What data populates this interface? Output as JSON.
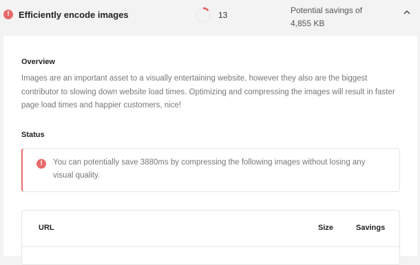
{
  "audit": {
    "title": "Efficiently encode images",
    "score": "13",
    "score_fraction": 0.13,
    "status_color": "#e76b6b",
    "savings_line1": "Potential savings of",
    "savings_line2": "4,855 KB",
    "expand_icon": "chevron-up-icon",
    "status_icon": "alert-circle-icon"
  },
  "overview": {
    "heading": "Overview",
    "text": "Images are an important asset to a visually entertaining website, however they also are the biggest contributor to slowing down website load times. Optimizing and compressing the images will result in faster page load times and happier customers, nice!"
  },
  "status": {
    "heading": "Status",
    "notice_icon": "alert-circle-icon",
    "notice_text": "You can potentially save 3880ms by compressing the following images without losing any visual quality."
  },
  "table": {
    "columns": [
      "URL",
      "Size",
      "Savings"
    ]
  }
}
